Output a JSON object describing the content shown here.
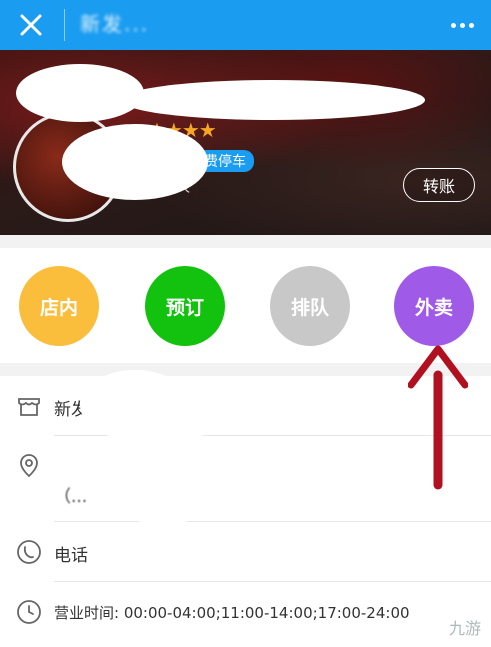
{
  "topbar": {
    "title": "新发...",
    "close_icon": "close-icon",
    "more_icon": "more-dots-icon"
  },
  "hero": {
    "stars": "★★★★",
    "tag": "费停车",
    "people_count": "人",
    "transfer_label": "转账"
  },
  "services": [
    {
      "label": "店内",
      "color": "#fbbd3c"
    },
    {
      "label": "预订",
      "color": "#12c20f"
    },
    {
      "label": "排队",
      "color": "#c8c8c8"
    },
    {
      "label": "外卖",
      "color": "#a05ae8"
    }
  ],
  "info": {
    "shop_name": "新发",
    "address": "（...",
    "phone_label": "电话",
    "hours": "营业时间: 00:00-04:00;11:00-14:00;17:00-24:00"
  },
  "annotation": {
    "arrow_color": "#b01020"
  },
  "watermark": "九游"
}
